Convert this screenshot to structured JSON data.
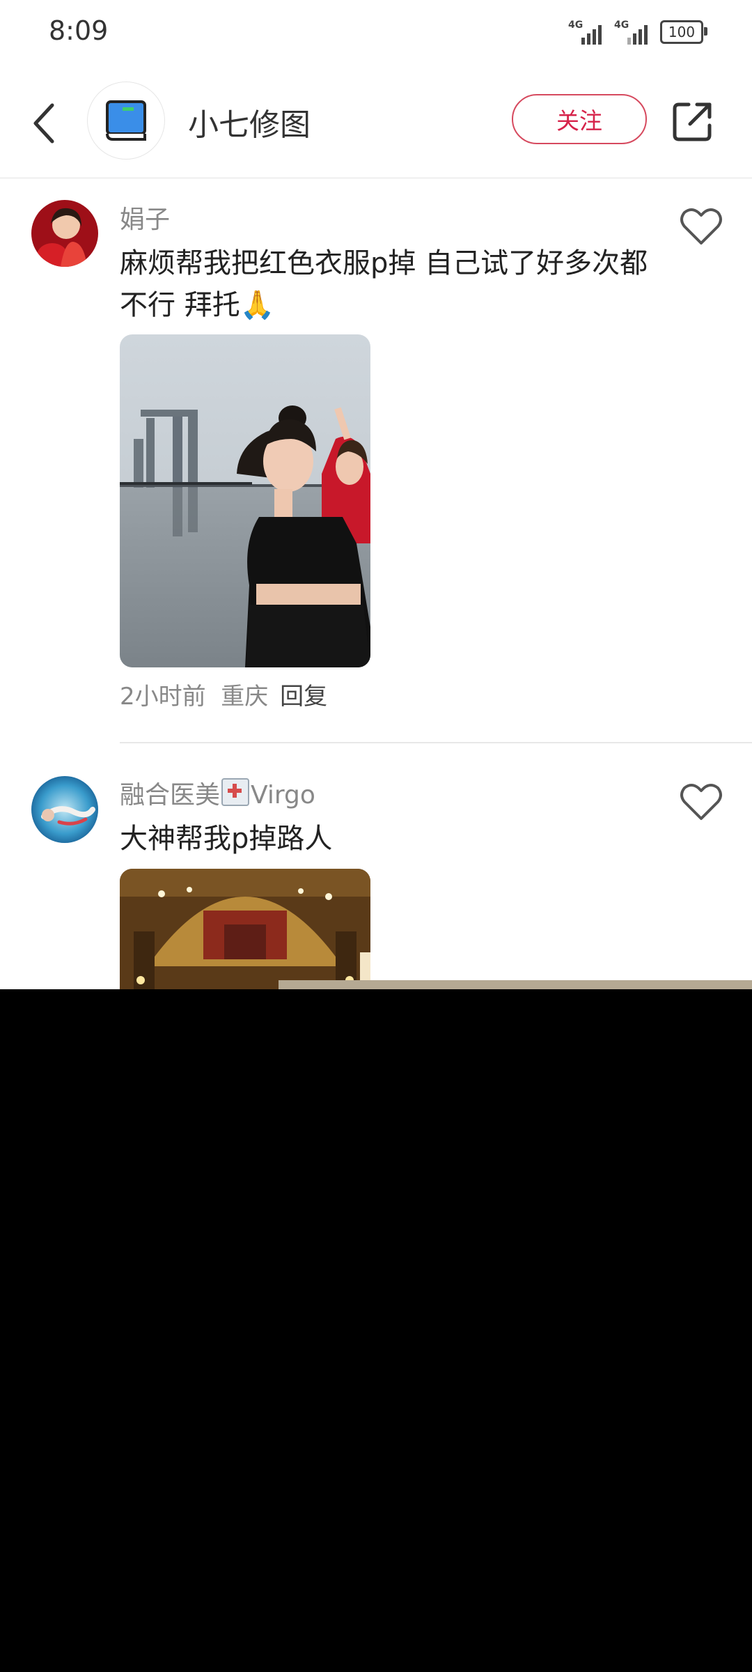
{
  "status_bar": {
    "time": "8:09",
    "network_1": "4G",
    "network_2": "4G",
    "battery": "100"
  },
  "header": {
    "title": "小七修图",
    "follow_label": "关注"
  },
  "posts": [
    {
      "username": "娟子",
      "text": "麻烦帮我把红色衣服p掉 自己试了好多次都不行 拜托🙏",
      "time": "2小时前",
      "location": "重庆",
      "reply_label": "回复"
    },
    {
      "username_part1": "融合医美",
      "username_part2": "Virgo",
      "text": "大神帮我p掉路人"
    }
  ]
}
